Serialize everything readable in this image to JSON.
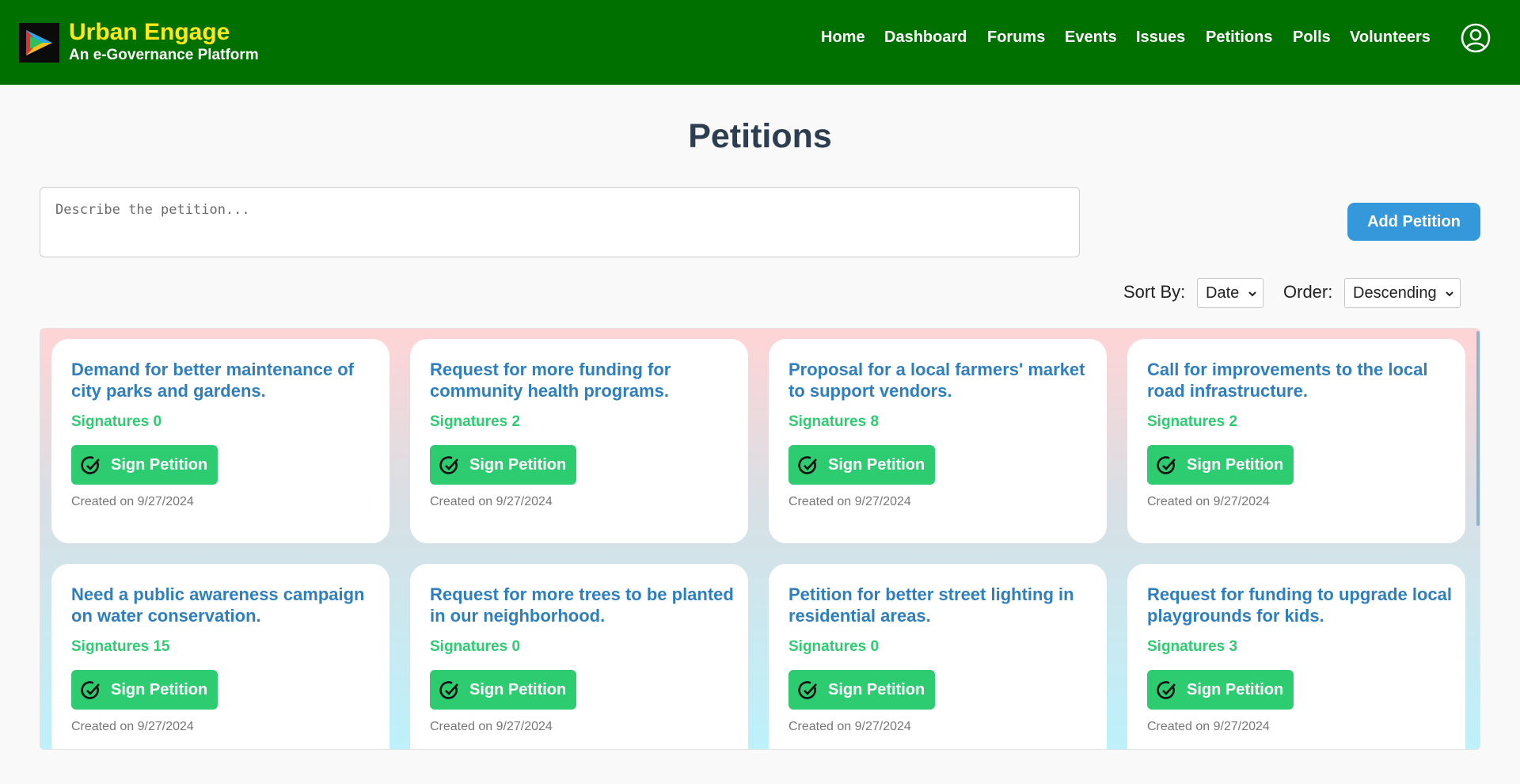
{
  "brand": {
    "title": "Urban Engage",
    "subtitle": "An e-Governance Platform"
  },
  "nav": [
    {
      "label": "Home"
    },
    {
      "label": "Dashboard"
    },
    {
      "label": "Forums"
    },
    {
      "label": "Events"
    },
    {
      "label": "Issues"
    },
    {
      "label": "Petitions"
    },
    {
      "label": "Polls"
    },
    {
      "label": "Volunteers"
    }
  ],
  "icons": {
    "logo": "play-logo-icon",
    "profile": "user-circle-icon",
    "sign": "check-circle-icon",
    "dropdown": "chevron-down-icon"
  },
  "page": {
    "title": "Petitions"
  },
  "form": {
    "placeholder": "Describe the petition...",
    "value": "",
    "add_label": "Add Petition"
  },
  "controls": {
    "sort_label": "Sort By:",
    "sort_value": "Date",
    "order_label": "Order:",
    "order_value": "Descending"
  },
  "petitions": [
    {
      "title": "Demand for better maintenance of city parks and gardens.",
      "signatures": "Signatures 0",
      "button": "Sign Petition",
      "created": "Created on 9/27/2024"
    },
    {
      "title": "Request for more funding for community health programs.",
      "signatures": "Signatures 2",
      "button": "Sign Petition",
      "created": "Created on 9/27/2024"
    },
    {
      "title": "Proposal for a local farmers' market to support vendors.",
      "signatures": "Signatures 8",
      "button": "Sign Petition",
      "created": "Created on 9/27/2024"
    },
    {
      "title": "Call for improvements to the local road infrastructure.",
      "signatures": "Signatures 2",
      "button": "Sign Petition",
      "created": "Created on 9/27/2024"
    },
    {
      "title": "Need a public awareness campaign on water conservation.",
      "signatures": "Signatures 15",
      "button": "Sign Petition",
      "created": "Created on 9/27/2024"
    },
    {
      "title": "Request for more trees to be planted in our neighborhood.",
      "signatures": "Signatures 0",
      "button": "Sign Petition",
      "created": "Created on 9/27/2024"
    },
    {
      "title": "Petition for better street lighting in residential areas.",
      "signatures": "Signatures 0",
      "button": "Sign Petition",
      "created": "Created on 9/27/2024"
    },
    {
      "title": "Request for funding to upgrade local playgrounds for kids.",
      "signatures": "Signatures 3",
      "button": "Sign Petition",
      "created": "Created on 9/27/2024"
    }
  ],
  "colors": {
    "navbar": "#007000",
    "brand_title": "#ffe81a",
    "page_title": "#2c3e50",
    "add_button": "#3498db",
    "sign_button": "#2ecc71",
    "card_title": "#2f7fbf",
    "signatures": "#2ecc71"
  }
}
